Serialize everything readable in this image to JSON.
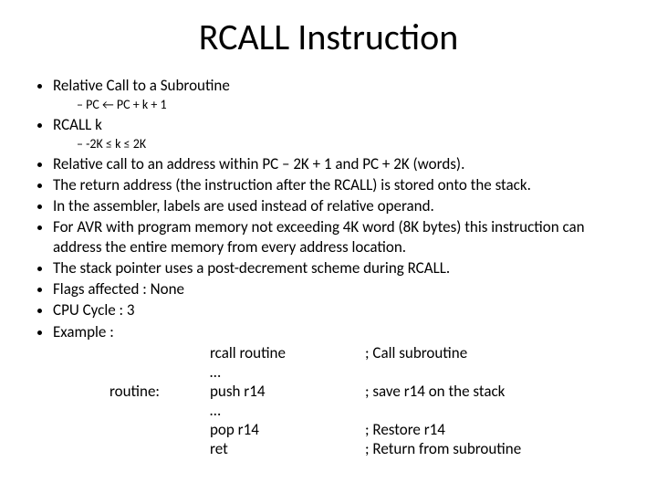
{
  "title": "RCALL Instruction",
  "bullets": {
    "b0": "Relative Call to a Subroutine",
    "s0": "PC ← PC + k + 1",
    "b1": "RCALL k",
    "s1": "-2K ≤ k ≤ 2K",
    "b2": "Relative call to an address within PC – 2K + 1 and PC + 2K (words).",
    "b3": "The return address (the instruction after the RCALL) is stored onto the stack.",
    "b4": "In the assembler, labels are used instead of relative operand.",
    "b5": "For AVR with program memory not exceeding 4K word (8K bytes) this instruction can address the entire memory from every address location.",
    "b6": "The stack pointer uses a post-decrement scheme during RCALL.",
    "b7": "Flags affected : None",
    "b8": "CPU Cycle : 3",
    "b9": "Example :"
  },
  "example": {
    "r0": {
      "label": "",
      "instr": "rcall routine",
      "comment": "; Call subroutine"
    },
    "r1": {
      "label": "",
      "instr": "…",
      "comment": ""
    },
    "r2": {
      "label": "routine:",
      "instr": "push r14",
      "comment": "; save r14 on the stack"
    },
    "r3": {
      "label": "",
      "instr": "…",
      "comment": ""
    },
    "r4": {
      "label": "",
      "instr": "pop r14",
      "comment": "; Restore r14"
    },
    "r5": {
      "label": "",
      "instr": "ret",
      "comment": "; Return from subroutine"
    }
  }
}
